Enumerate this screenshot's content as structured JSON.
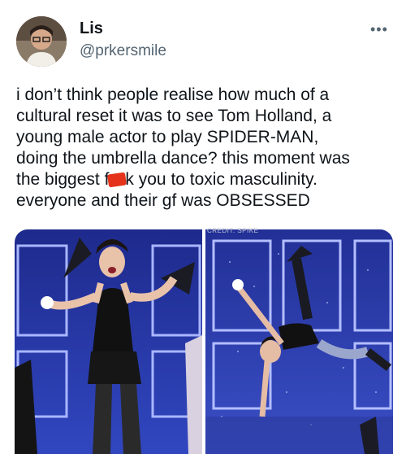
{
  "header": {
    "display_name": "Lis",
    "handle": "@prkersmile",
    "more_icon": "more-horizontal-icon"
  },
  "tweet": {
    "lines": [
      "i don’t think people realise how much of a",
      "cultural reset it was to see Tom Holland, a",
      "young male actor to play SPIDER-MAN,",
      "doing the umbrella dance? this moment was"
    ],
    "line5_before": "the biggest f",
    "line5_after": "k you to toxic masculinity.",
    "line6": "everyone and their gf was OBSESSED"
  },
  "media": {
    "credit": "CREDIT: SPIKE"
  },
  "colors": {
    "censor": "#e5321a",
    "stage_blue": "#2a3aa8"
  }
}
